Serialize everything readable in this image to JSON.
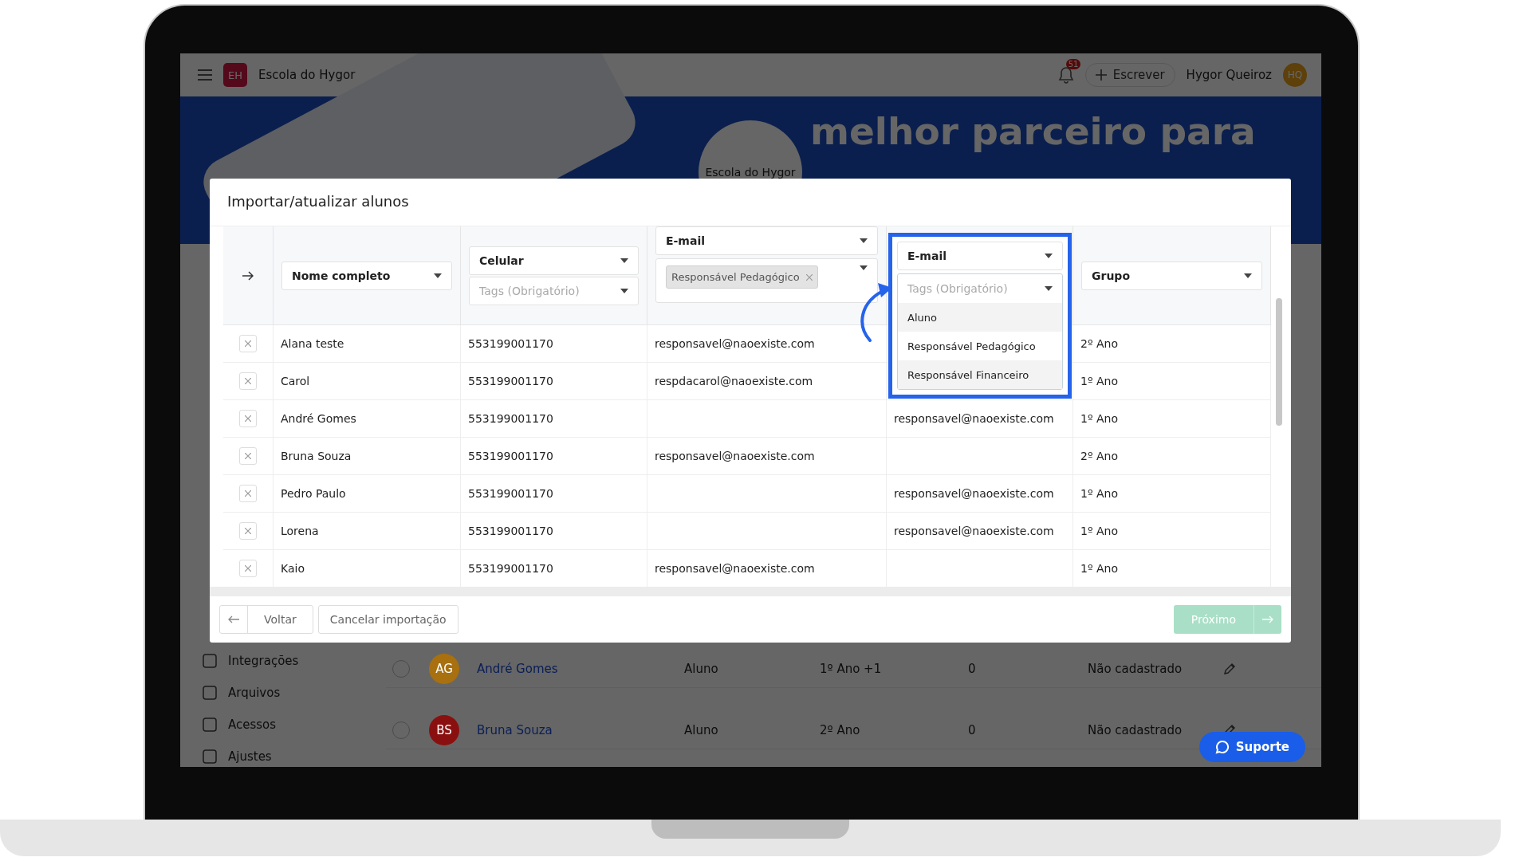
{
  "app": {
    "school_badge": "EH",
    "school_name": "Escola do Hygor",
    "notification_count": "51",
    "write_button": "Escrever",
    "user_name": "Hygor Queiroz",
    "user_initials": "HQ"
  },
  "banner": {
    "logo_text": "Escola do Hygor",
    "headline": "melhor parceiro para"
  },
  "sidebar": {
    "items": [
      {
        "label": "Integrações"
      },
      {
        "label": "Arquivos"
      },
      {
        "label": "Acessos"
      },
      {
        "label": "Ajustes"
      }
    ]
  },
  "students": [
    {
      "selected": false,
      "initials": "AG",
      "color": "#a8700f",
      "name": "André Gomes",
      "role": "Aluno",
      "group": "1º Ano +1",
      "count": "0",
      "status": "Não cadastrado"
    },
    {
      "selected": false,
      "initials": "BS",
      "color": "#8a1010",
      "name": "Bruna Souza",
      "role": "Aluno",
      "group": "2º Ano",
      "count": "0",
      "status": "Não cadastrado"
    }
  ],
  "support_button": "Suporte",
  "modal": {
    "title": "Importar/atualizar alunos",
    "columns": [
      {
        "field": "Nome completo"
      },
      {
        "field": "Celular",
        "tags_placeholder": "Tags (Obrigatório)"
      },
      {
        "field": "E-mail",
        "tags": [
          "Responsável Pedagógico"
        ]
      },
      {
        "field": "E-mail",
        "tags_placeholder": "Tags (Obrigatório)",
        "options": [
          {
            "label": "Aluno",
            "hovered": true
          },
          {
            "label": "Responsável Pedagógico",
            "hovered": false
          },
          {
            "label": "Responsável Financeiro",
            "hovered": true
          }
        ]
      },
      {
        "field": "Grupo"
      }
    ],
    "rows": [
      {
        "name": "Alana teste",
        "phone": "553199001170",
        "email_1": "responsavel@naoexiste.com",
        "group": "2º Ano"
      },
      {
        "name": "Carol",
        "phone": "553199001170",
        "email_1": "respdacarol@naoexiste.com",
        "group": "1º Ano"
      },
      {
        "name": "André Gomes",
        "phone": "553199001170",
        "email_2": "responsavel@naoexiste.com",
        "group": "1º Ano"
      },
      {
        "name": "Bruna Souza",
        "phone": "553199001170",
        "email_1": "responsavel@naoexiste.com",
        "group": "2º Ano"
      },
      {
        "name": "Pedro Paulo",
        "phone": "553199001170",
        "email_2": "responsavel@naoexiste.com",
        "group": "1º Ano"
      },
      {
        "name": "Lorena",
        "phone": "553199001170",
        "email_2": "responsavel@naoexiste.com",
        "group": "1º Ano"
      },
      {
        "name": "Kaio",
        "phone": "553199001170",
        "email_1": "responsavel@naoexiste.com",
        "group": "1º Ano"
      }
    ],
    "back_button": "Voltar",
    "cancel_button": "Cancelar importação",
    "next_button": {
      "label": "Próximo",
      "disabled": true
    }
  }
}
